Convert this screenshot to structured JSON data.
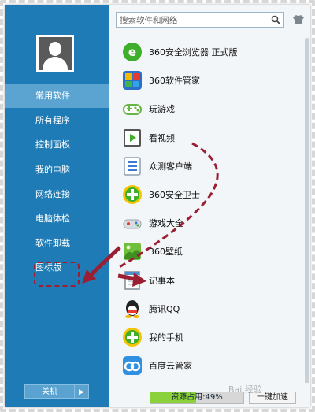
{
  "sidebar": {
    "items": [
      {
        "label": "常用软件",
        "active": true
      },
      {
        "label": "所有程序"
      },
      {
        "label": "控制面板"
      },
      {
        "label": "我的电脑"
      },
      {
        "label": "网络连接"
      },
      {
        "label": "电脑体检"
      },
      {
        "label": "软件卸载"
      },
      {
        "label": "图标版"
      }
    ],
    "shutdown_label": "关机",
    "shutdown_arrow": "▶"
  },
  "search": {
    "placeholder": "搜索软件和网络"
  },
  "apps": [
    {
      "label": "360安全浏览器 正式版",
      "icon": "360-browser-icon"
    },
    {
      "label": "360软件管家",
      "icon": "360-software-manager-icon"
    },
    {
      "label": "玩游戏",
      "icon": "gamepad-icon"
    },
    {
      "label": "看视频",
      "icon": "video-icon"
    },
    {
      "label": "众测客户端",
      "icon": "checklist-icon"
    },
    {
      "label": "360安全卫士",
      "icon": "360-security-icon"
    },
    {
      "label": "游戏大全",
      "icon": "game-collection-icon"
    },
    {
      "label": "360壁纸",
      "icon": "wallpaper-icon"
    },
    {
      "label": "记事本",
      "icon": "notepad-icon"
    },
    {
      "label": "腾讯QQ",
      "icon": "qq-icon"
    },
    {
      "label": "我的手机",
      "icon": "my-phone-icon"
    },
    {
      "label": "百度云管家",
      "icon": "baidu-cloud-icon"
    }
  ],
  "resource": {
    "label": "资源占用:49%",
    "percent": 49
  },
  "boost_label": "一键加速",
  "watermark": "Bai 经验",
  "colors": {
    "sidebar": "#1f7bb5",
    "sidebar_active": "#5ba4d2",
    "annotation": "#9b1f32",
    "resource_fill": "#8bd13c"
  }
}
